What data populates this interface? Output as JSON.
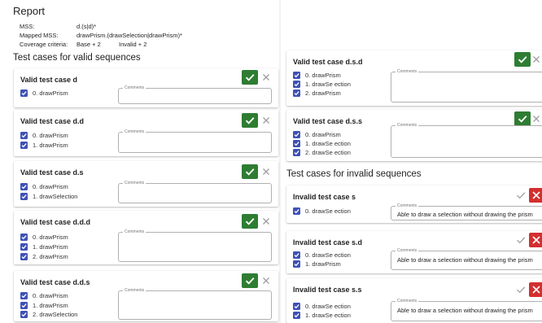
{
  "report": {
    "title": "Report",
    "mss_label": "MSS:",
    "mss_value": "d.(s|d)*",
    "mapped_label": "Mapped MSS:",
    "mapped_value": "drawPrism.(drawSelection|drawPrism)*",
    "coverage_label": "Coverage criteria:",
    "coverage_base": "Base + 2",
    "coverage_invalid": "Invalid + 2"
  },
  "valid_title": "Test cases for valid sequences",
  "invalid_title": "Test cases for invalid sequences",
  "comments_label": "Comments",
  "colors": {
    "accept": "#2e7d32",
    "reject": "#d32f2f",
    "checkbox": "#3f51b5"
  },
  "valid_cases": [
    {
      "title": "Valid test case d",
      "steps": [
        "0. drawPrism"
      ]
    },
    {
      "title": "Valid test case d.d",
      "steps": [
        "0. drawPrism",
        "1. drawPrism"
      ]
    },
    {
      "title": "Valid test case d.s",
      "steps": [
        "0. drawPrism",
        "1. drawSelection"
      ]
    },
    {
      "title": "Valid test case d.d.d",
      "steps": [
        "0. drawPrism",
        "1. drawPrism",
        "2. drawPrism"
      ]
    },
    {
      "title": "Valid test case d.d.s",
      "steps": [
        "0. drawPrism",
        "1. drawPrism",
        "2. drawSelection"
      ]
    },
    {
      "title": "Valid test case d.s.d",
      "steps": [
        "0. drawPrism",
        "1. drawSe ection",
        "2. drawPrism"
      ]
    },
    {
      "title": "Valid test case d.s.s",
      "steps": [
        "0. drawPrism",
        "1. drawSe ection",
        "2. drawSe ection"
      ]
    }
  ],
  "invalid_cases": [
    {
      "title": "Invalid test case s",
      "steps": [
        "0. drawSe ection"
      ],
      "comment": "Able to draw a selection without drawing the prism"
    },
    {
      "title": "Invalid test case s.d",
      "steps": [
        "0. drawSe ection",
        "1. drawPrism"
      ],
      "comment": "Able to draw a selection without drawing the prism"
    },
    {
      "title": "Invalid test case s.s",
      "steps": [
        "0. drawSe ection",
        "1. drawSe ection"
      ],
      "comment": "Able to draw a selection without drawing the prism"
    }
  ]
}
